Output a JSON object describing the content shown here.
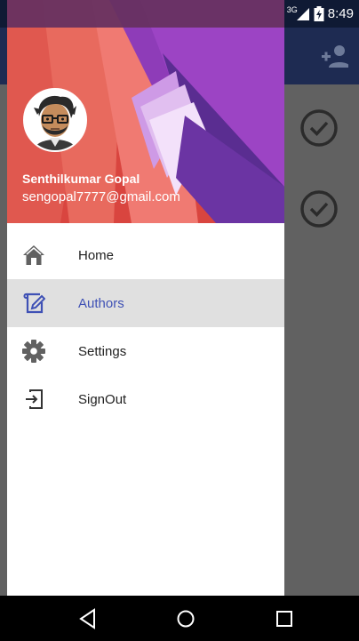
{
  "status_bar": {
    "network": "3G",
    "time": "8:49"
  },
  "user": {
    "name": "Senthilkumar Gopal",
    "email": "sengopal7777@gmail.com"
  },
  "menu": [
    {
      "label": "Home",
      "icon": "home-icon",
      "active": false
    },
    {
      "label": "Authors",
      "icon": "edit-note-icon",
      "active": true
    },
    {
      "label": "Settings",
      "icon": "gear-icon",
      "active": false
    },
    {
      "label": "SignOut",
      "icon": "sign-out-icon",
      "active": false
    }
  ],
  "colors": {
    "accent": "#3f51b5",
    "app_bar": "#1e2b52",
    "active_row": "#e0e0e0",
    "icon": "#616161"
  }
}
